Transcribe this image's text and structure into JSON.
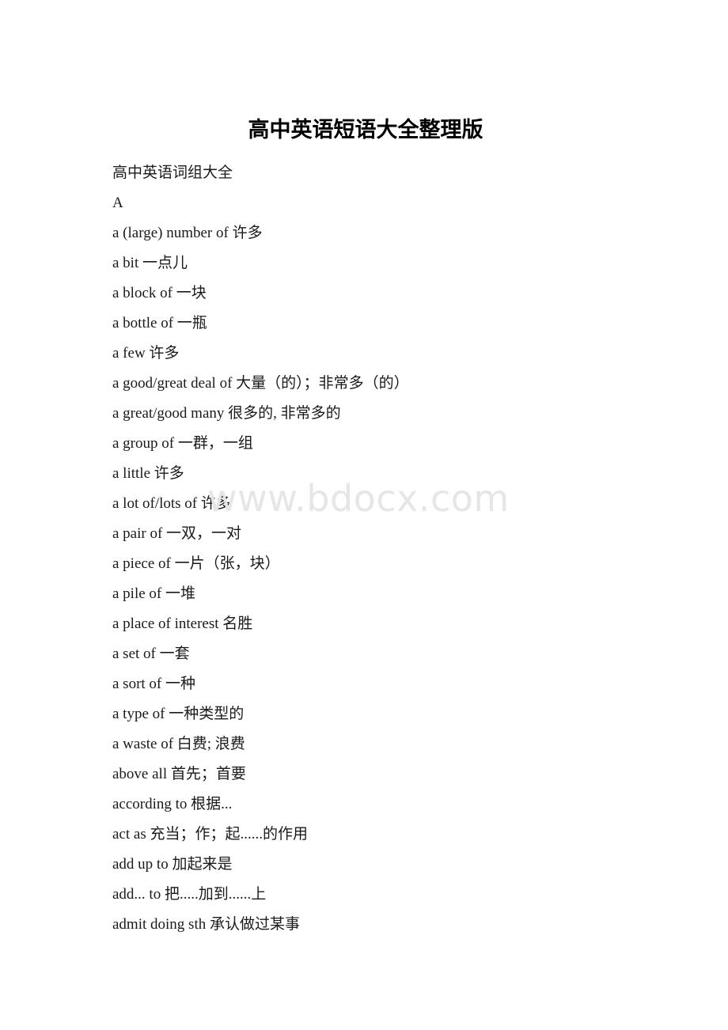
{
  "document": {
    "title": "高中英语短语大全整理版",
    "watermark": "www.bdocx.com",
    "watermark_color": "#e6e6e6",
    "text_color": "#000000",
    "background_color": "#ffffff",
    "lines": [
      "高中英语词组大全",
      "A",
      "a (large) number of 许多",
      "a bit 一点儿",
      "a block of 一块",
      "a bottle of 一瓶",
      "a few 许多",
      "a good/great deal of 大量（的）；非常多（的）",
      "a great/good many 很多的, 非常多的",
      "a group of 一群，一组",
      "a little 许多",
      "a lot of/lots of 许多",
      "a pair of 一双，一对",
      "a piece of 一片（张，块）",
      "a pile of 一堆",
      "a place of interest 名胜",
      "a set of 一套",
      "a sort of 一种",
      "a type of 一种类型的",
      "a waste of 白费; 浪费",
      "above all 首先；首要",
      "according to 根据...",
      "act as 充当；作；起......的作用",
      "add up to 加起来是",
      "add... to 把.....加到......上",
      "admit doing sth 承认做过某事"
    ]
  }
}
